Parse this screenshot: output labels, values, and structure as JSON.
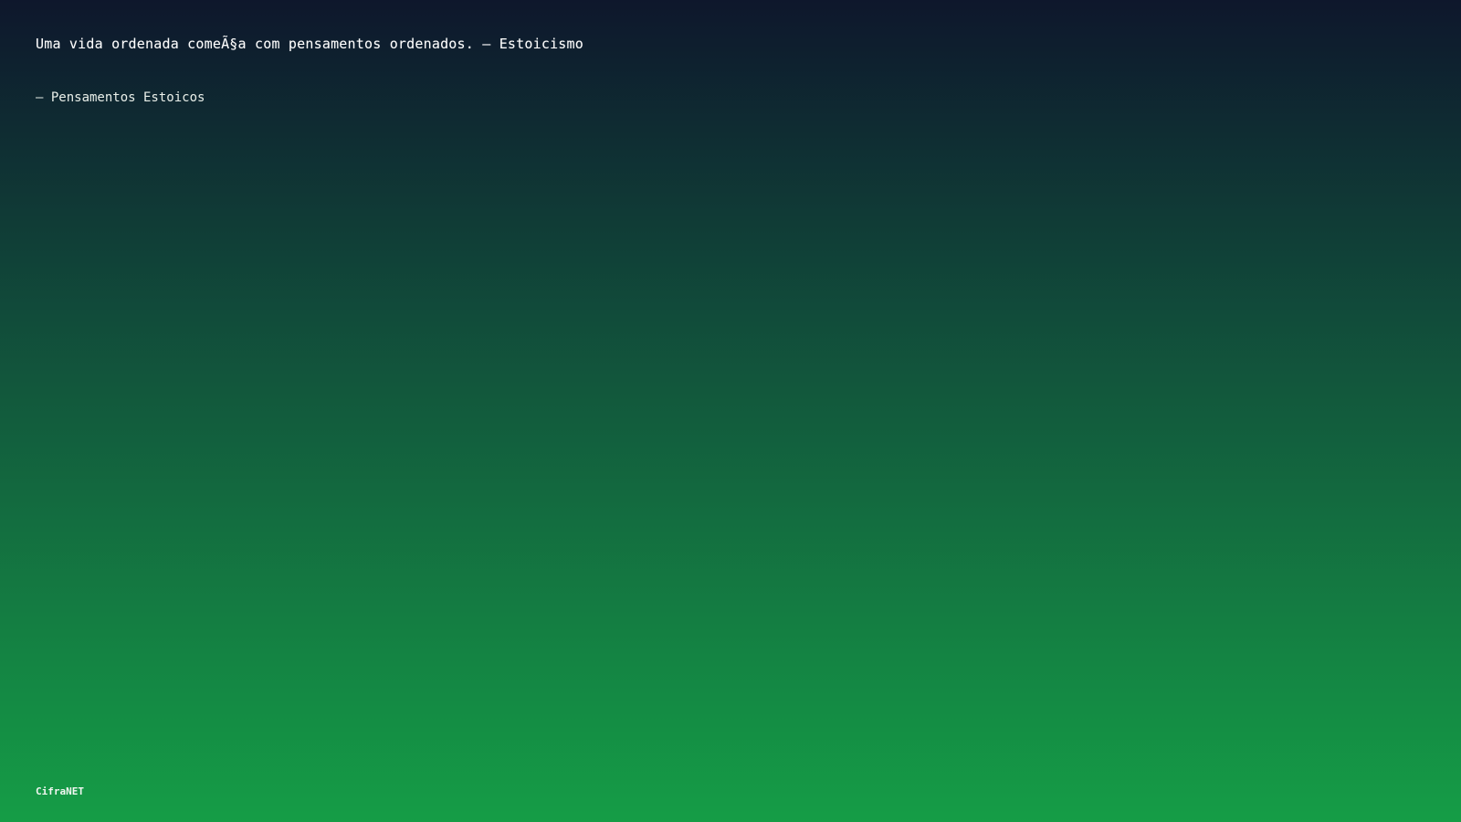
{
  "quote": {
    "text": "Uma vida ordenada comeÃ§a com pensamentos ordenados. – Estoicismo"
  },
  "author": {
    "text": "– Pensamentos Estoicos"
  },
  "brand": {
    "label": "CifraNET"
  },
  "colors": {
    "gradient_top": "#0e172c",
    "gradient_bottom": "#159d46",
    "text": "#ffffff"
  }
}
